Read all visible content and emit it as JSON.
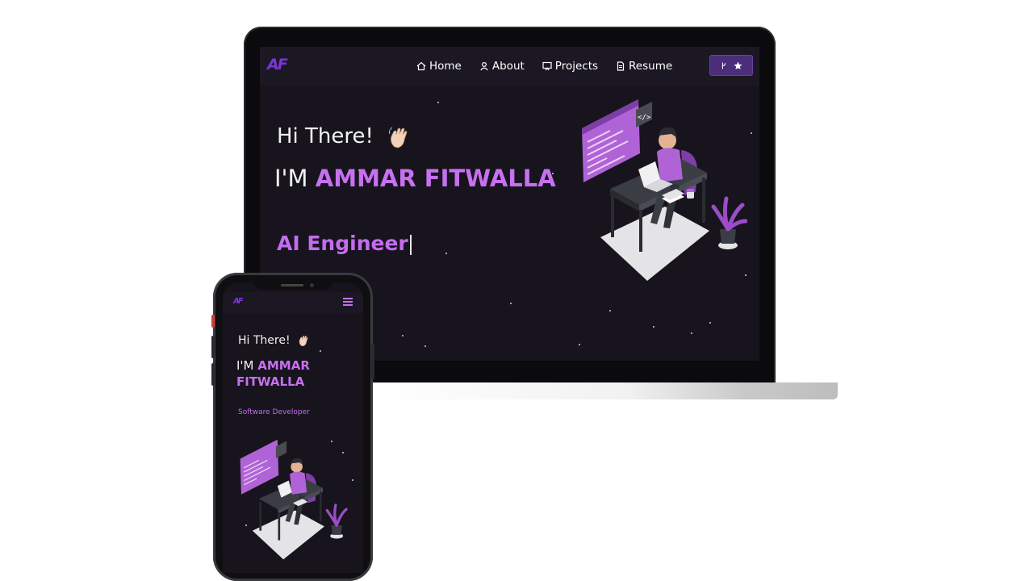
{
  "desktop": {
    "logo": "AF",
    "nav": [
      {
        "label": "Home",
        "icon": "home-icon"
      },
      {
        "label": "About",
        "icon": "user-icon"
      },
      {
        "label": "Projects",
        "icon": "projects-icon"
      },
      {
        "label": "Resume",
        "icon": "document-icon"
      }
    ],
    "github_button_icons": [
      "fork-icon",
      "star-icon"
    ],
    "greeting": "Hi There!",
    "greeting_emoji": "wave-icon",
    "intro_prefix": "I'M ",
    "name": "AMMAR FITWALLA",
    "role": "AI Engineer"
  },
  "mobile": {
    "logo": "AF",
    "menu_icon": "hamburger-icon",
    "greeting": "Hi There!",
    "intro_prefix": "I'M ",
    "name_line1": "AMMAR",
    "name_line2": "FITWALLA",
    "role": "Software Developer"
  },
  "colors": {
    "accent": "#c770f0",
    "logo": "#7b35d6",
    "background": "#17141d",
    "nav": "#1b1823",
    "button": "#4b2d7a"
  }
}
